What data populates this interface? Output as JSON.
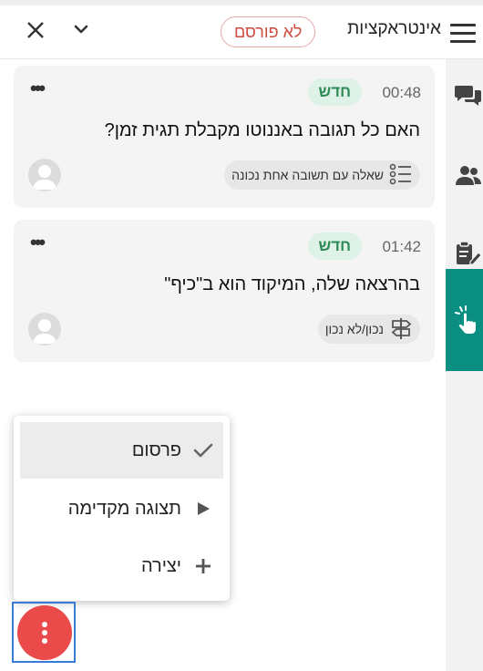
{
  "header": {
    "title": "אינטראקציות",
    "status_badge": "לא פורסם",
    "icons": [
      "menu-icon",
      "close-icon",
      "chevron-down-icon"
    ]
  },
  "interactions": [
    {
      "time": "00:48",
      "badge": "חדש",
      "question": "האם כל תגובה באננוטו מקבלת תגית זמן?",
      "type_label": "שאלה עם תשובה אחת נכונה",
      "type_icon": "list-icon"
    },
    {
      "time": "01:42",
      "badge": "חדש",
      "question": "בהרצאה שלה, המיקוד הוא ב\"כיף\"",
      "type_label": "נכון/לא נכון",
      "type_icon": "signpost-icon"
    }
  ],
  "menu": {
    "items": [
      {
        "label": "פרסום",
        "icon": "check-icon",
        "selected": true
      },
      {
        "label": "תצוגה מקדימה",
        "icon": "play-icon",
        "selected": false
      },
      {
        "label": "יצירה",
        "icon": "plus-icon",
        "selected": false
      }
    ]
  },
  "sidebar": {
    "icons": [
      "chat-bubbles-icon",
      "people-icon",
      "clipboard-edit-icon",
      "tap-hand-icon"
    ],
    "active_color": "#0a8f82"
  },
  "colors": {
    "accent": "#0a8f82",
    "fab": "#ea4a4a",
    "badge_unpublished": "#d04b40",
    "badge_new_bg": "#dff2e7",
    "badge_new_text": "#2e8b57"
  }
}
